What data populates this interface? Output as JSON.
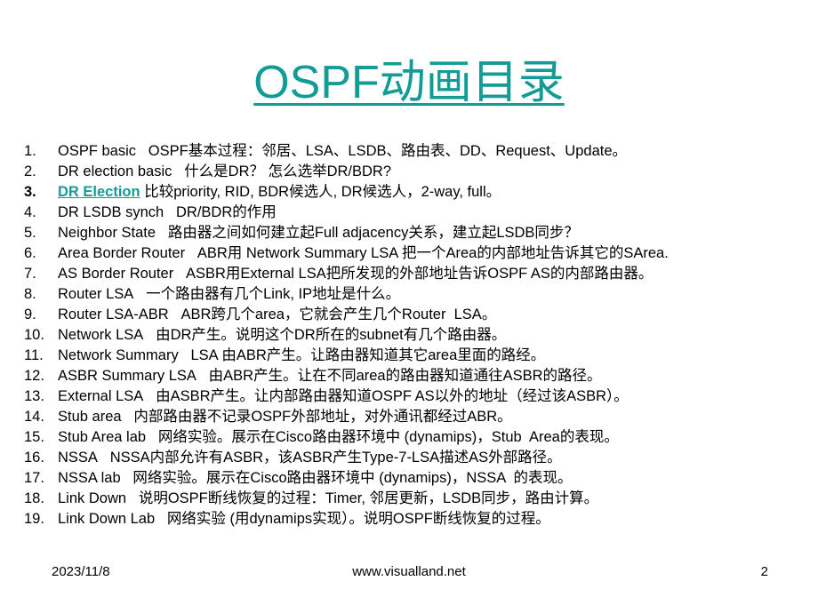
{
  "slide": {
    "title": "OSPF动画目录",
    "title_color": "#139b96",
    "items": [
      {
        "num": "1.",
        "name": "OSPF basic",
        "desc": "OSPF基本过程：邻居、LSA、LSDB、路由表、DD、Request、Update。"
      },
      {
        "num": "2.",
        "name": "DR election basic",
        "desc": "什么是DR？ 怎么选举DR/BDR?"
      },
      {
        "num": "3.",
        "name": "DR Election",
        "desc": "比较priority, RID, BDR候选人, DR候选人，2-way, full。",
        "is_link": true
      },
      {
        "num": "4.",
        "name": "DR LSDB synch",
        "desc": "DR/BDR的作用"
      },
      {
        "num": "5.",
        "name": "Neighbor State",
        "desc": "路由器之间如何建立起Full adjacency关系，建立起LSDB同步？"
      },
      {
        "num": "6.",
        "name": "Area Border Router",
        "desc": "ABR用 Network Summary LSA 把一个Area的内部地址告诉其它的SArea."
      },
      {
        "num": "7.",
        "name": "AS Border Router",
        "desc": "ASBR用External LSA把所发现的外部地址告诉OSPF AS的内部路由器。"
      },
      {
        "num": "8.",
        "name": "Router LSA",
        "desc": "一个路由器有几个Link, IP地址是什么。"
      },
      {
        "num": "9.",
        "name": "Router LSA-ABR",
        "desc": "ABR跨几个area，它就会产生几个Router  LSA。"
      },
      {
        "num": "10.",
        "name": "Network LSA",
        "desc": "由DR产生。说明这个DR所在的subnet有几个路由器。"
      },
      {
        "num": "11.",
        "name": "Network Summary",
        "desc": "LSA 由ABR产生。让路由器知道其它area里面的路经。"
      },
      {
        "num": "12.",
        "name": "ASBR Summary LSA",
        "desc": "由ABR产生。让在不同area的路由器知道通往ASBR的路径。"
      },
      {
        "num": "13.",
        "name": "External LSA",
        "desc": "由ASBR产生。让内部路由器知道OSPF AS以外的地址（经过该ASBR）。"
      },
      {
        "num": "14.",
        "name": "Stub area",
        "desc": "内部路由器不记录OSPF外部地址，对外通讯都经过ABR。"
      },
      {
        "num": "15.",
        "name": "Stub Area lab",
        "desc": "网络实验。展示在Cisco路由器环境中 (dynamips)，Stub  Area的表现。"
      },
      {
        "num": "16.",
        "name": "NSSA",
        "desc": "NSSA内部允许有ASBR，该ASBR产生Type-7-LSA描述AS外部路径。"
      },
      {
        "num": "17.",
        "name": "NSSA lab",
        "desc": "网络实验。展示在Cisco路由器环境中 (dynamips)，NSSA  的表现。"
      },
      {
        "num": "18.",
        "name": "Link Down",
        "desc": "说明OSPF断线恢复的过程：Timer, 邻居更新，LSDB同步，路由计算。"
      },
      {
        "num": "19.",
        "name": "Link Down Lab",
        "desc": "网络实验 (用dynamips实现）。说明OSPF断线恢复的过程。"
      }
    ]
  },
  "footer": {
    "date": "2023/11/8",
    "url": "www.visualland.net",
    "page": "2"
  }
}
